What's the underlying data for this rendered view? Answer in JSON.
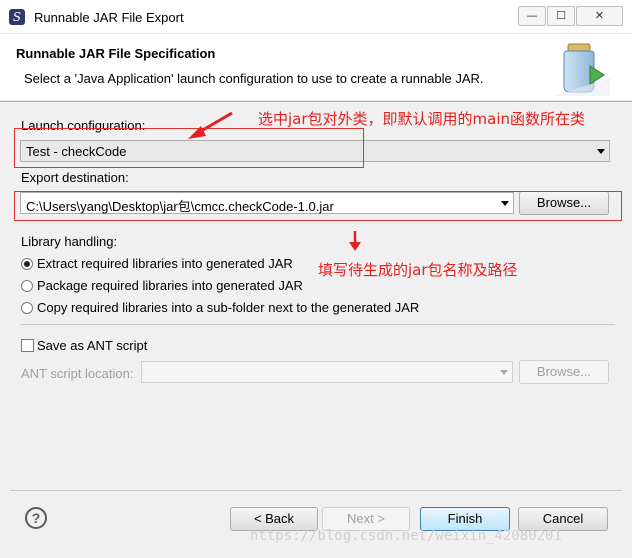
{
  "window": {
    "title": "Runnable JAR File Export",
    "controls": {
      "minimize": "—",
      "maximize": "☐",
      "close": "✕"
    }
  },
  "header": {
    "title": "Runnable JAR File Specification",
    "description": "Select a 'Java Application' launch configuration to use to create a runnable JAR."
  },
  "launch": {
    "label": "Launch configuration:",
    "value": "Test - checkCode"
  },
  "export": {
    "label": "Export destination:",
    "value": "C:\\Users\\yang\\Desktop\\jar包\\cmcc.checkCode-1.0.jar",
    "browse": "Browse..."
  },
  "library": {
    "label": "Library handling:",
    "options": [
      {
        "label": "Extract required libraries into generated JAR",
        "selected": true
      },
      {
        "label": "Package required libraries into generated JAR",
        "selected": false
      },
      {
        "label": "Copy required libraries into a sub-folder next to the generated JAR",
        "selected": false
      }
    ]
  },
  "ant": {
    "checkbox_label": "Save as ANT script",
    "checked": false,
    "location_label": "ANT script location:",
    "browse": "Browse..."
  },
  "annotations": {
    "launch_note": "选中jar包对外类，即默认调用的main函数所在类",
    "export_note": "填写待生成的jar包名称及路径"
  },
  "footer": {
    "help": "?",
    "back": "< Back",
    "next": "Next >",
    "finish": "Finish",
    "cancel": "Cancel"
  },
  "watermark": "https://blog.csdn.net/weixin_42080201"
}
